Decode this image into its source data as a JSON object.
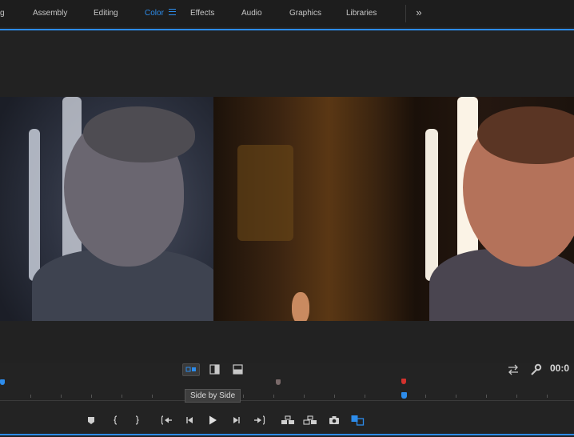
{
  "workspaces": {
    "tabs": [
      {
        "label": "g"
      },
      {
        "label": "Assembly"
      },
      {
        "label": "Editing"
      },
      {
        "label": "Color"
      },
      {
        "label": "Effects"
      },
      {
        "label": "Audio"
      },
      {
        "label": "Graphics"
      },
      {
        "label": "Libraries"
      }
    ],
    "active": "Color",
    "overflow_label": "»"
  },
  "colors": {
    "accent": "#2d8ceb",
    "marker_red": "#d3322e",
    "marker_blue": "#2d8ceb",
    "marker_gray": "#7a6a6a"
  },
  "monitor": {
    "comparison_modes": [
      "side-by-side",
      "vertical-split",
      "horizontal-split"
    ],
    "active_mode": "side-by-side",
    "timecode": "00:0"
  },
  "tooltip": {
    "text": "Side by Side"
  },
  "icons": {
    "swap": "swap-arrows-icon",
    "settings": "wrench-icon"
  },
  "transport": {
    "buttons": [
      "add-marker",
      "mark-in",
      "mark-out",
      "go-to-in",
      "step-back",
      "play",
      "step-forward",
      "go-to-out",
      "lift",
      "extract",
      "export-frame",
      "comparison-view"
    ]
  }
}
